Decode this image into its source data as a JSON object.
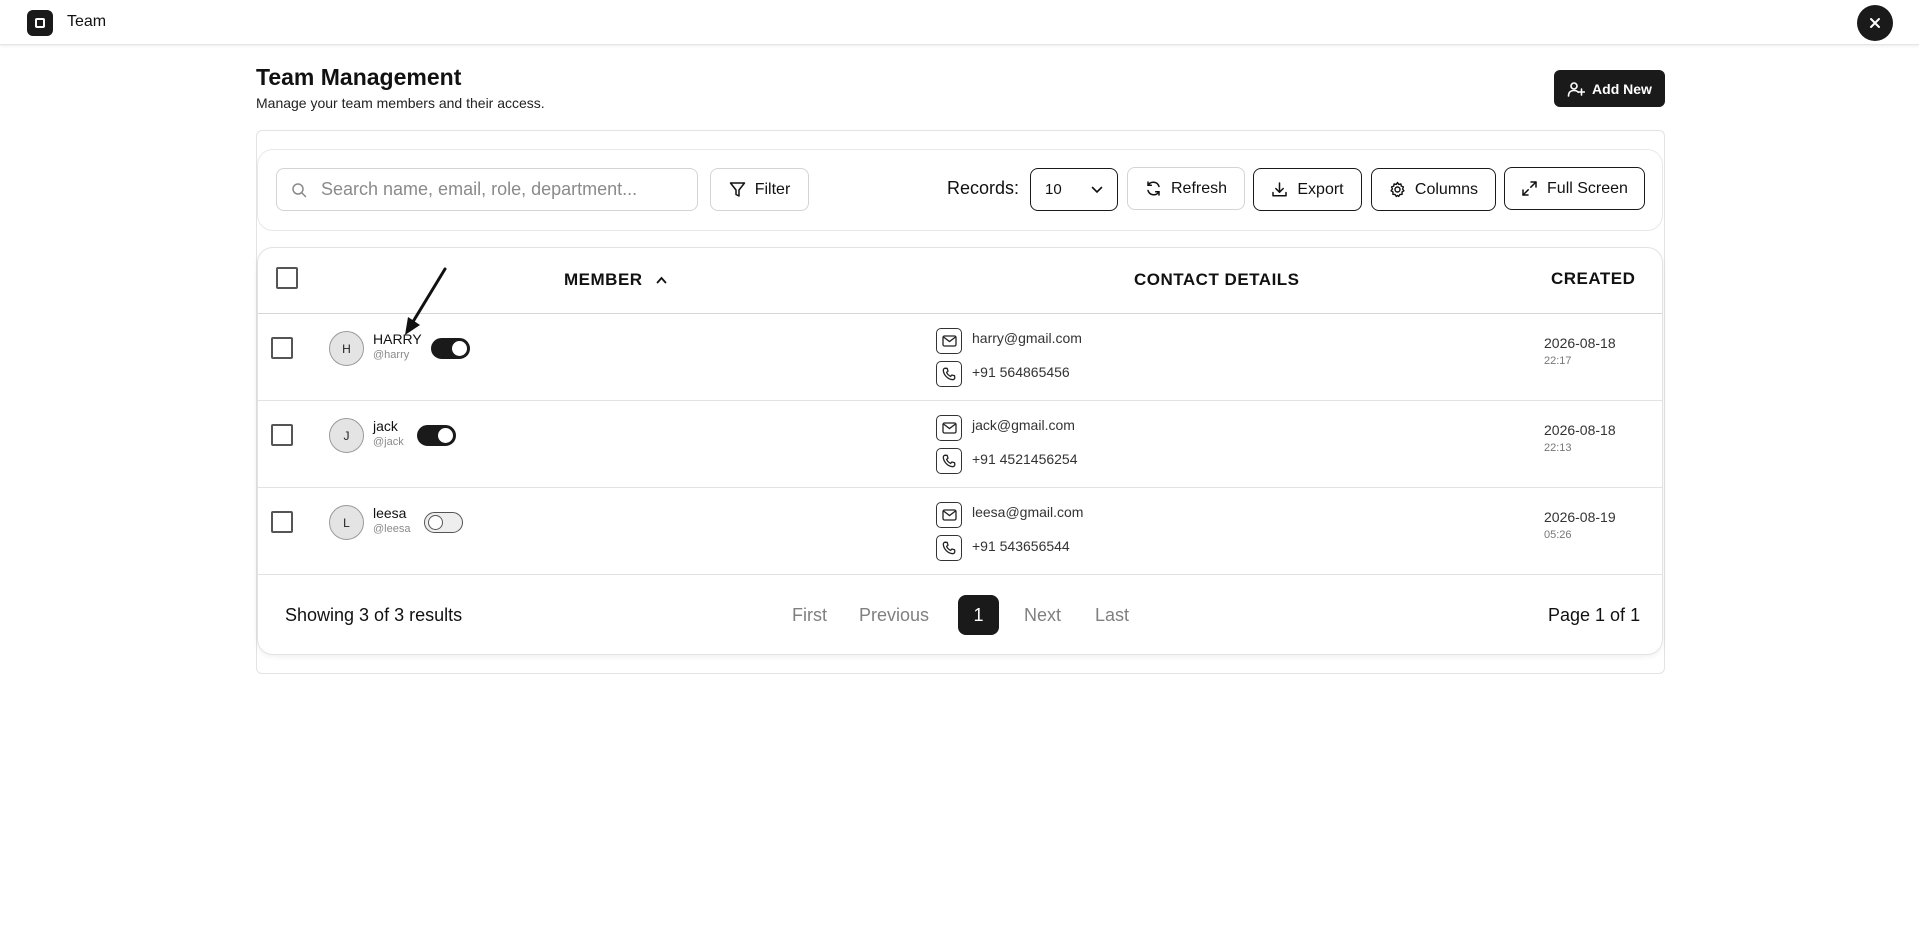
{
  "app": {
    "title": "Team"
  },
  "header": {
    "title": "Team Management",
    "subtitle": "Manage your team members and their access.",
    "add_new_label": "Add New"
  },
  "toolbar": {
    "search_placeholder": "Search name, email, role, department...",
    "filter_label": "Filter",
    "records_label": "Records:",
    "records_value": "10",
    "refresh_label": "Refresh",
    "export_label": "Export",
    "columns_label": "Columns",
    "fullscreen_label": "Full Screen"
  },
  "table": {
    "columns": {
      "member": "MEMBER",
      "contact": "CONTACT DETAILS",
      "created": "CREATED"
    },
    "sort": {
      "column": "member",
      "direction": "ascending",
      "icon": "chevron-up-icon"
    },
    "rows": [
      {
        "initial": "H",
        "name": "HARRY",
        "handle": "@harry",
        "active": true,
        "email": "harry@gmail.com",
        "phone": "+91 564865456",
        "date": "2026-08-18",
        "time": "22:17"
      },
      {
        "initial": "J",
        "name": "jack",
        "handle": "@jack",
        "active": true,
        "email": "jack@gmail.com",
        "phone": "+91 4521456254",
        "date": "2026-08-18",
        "time": "22:13"
      },
      {
        "initial": "L",
        "name": "leesa",
        "handle": "@leesa",
        "active": false,
        "email": "leesa@gmail.com",
        "phone": "+91 543656544",
        "date": "2026-08-19",
        "time": "05:26"
      }
    ]
  },
  "footer": {
    "showing": "Showing 3 of 3 results",
    "first": "First",
    "previous": "Previous",
    "current_page": "1",
    "next": "Next",
    "last": "Last",
    "page_of": "Page 1 of 1"
  },
  "colors": {
    "accent": "#1a1a1a",
    "border": "#d4d4d4",
    "muted_text": "#808080"
  }
}
